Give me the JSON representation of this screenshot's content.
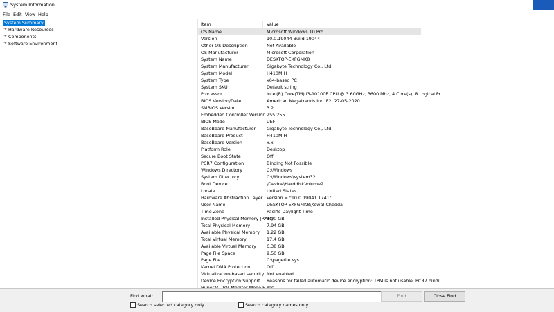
{
  "window": {
    "title": "System Information",
    "accent_color": "#1a5ab8"
  },
  "menu": [
    {
      "label": "File"
    },
    {
      "label": "Edit"
    },
    {
      "label": "View"
    },
    {
      "label": "Help"
    }
  ],
  "tree": [
    {
      "label": "System Summary",
      "expander": "",
      "selected": true
    },
    {
      "label": "Hardware Resources",
      "expander": "+"
    },
    {
      "label": "Components",
      "expander": "+"
    },
    {
      "label": "Software Environment",
      "expander": "+"
    }
  ],
  "table": {
    "headers": {
      "item": "Item",
      "value": "Value"
    },
    "rows": [
      {
        "item": "OS Name",
        "value": "Microsoft Windows 10 Pro"
      },
      {
        "item": "Version",
        "value": "10.0.19044 Build 19044"
      },
      {
        "item": "Other OS Description",
        "value": "Not Available"
      },
      {
        "item": "OS Manufacturer",
        "value": "Microsoft Corporation"
      },
      {
        "item": "System Name",
        "value": "DESKTOP-EKFGMK8"
      },
      {
        "item": "System Manufacturer",
        "value": "Gigabyte Technology Co., Ltd."
      },
      {
        "item": "System Model",
        "value": "H410M H"
      },
      {
        "item": "System Type",
        "value": "x64-based PC"
      },
      {
        "item": "System SKU",
        "value": "Default string"
      },
      {
        "item": "Processor",
        "value": "Intel(R) Core(TM) i3-10100F CPU @ 3.60GHz, 3600 Mhz, 4 Core(s), 8 Logical Pr..."
      },
      {
        "item": "BIOS Version/Date",
        "value": "American Megatrends Inc. F2, 27-05-2020"
      },
      {
        "item": "SMBIOS Version",
        "value": "3.2"
      },
      {
        "item": "Embedded Controller Version",
        "value": "255.255"
      },
      {
        "item": "BIOS Mode",
        "value": "UEFI"
      },
      {
        "item": "BaseBoard Manufacturer",
        "value": "Gigabyte Technology Co., Ltd."
      },
      {
        "item": "BaseBoard Product",
        "value": "H410M H"
      },
      {
        "item": "BaseBoard Version",
        "value": "x.x"
      },
      {
        "item": "Platform Role",
        "value": "Desktop"
      },
      {
        "item": "Secure Boot State",
        "value": "Off"
      },
      {
        "item": "PCR7 Configuration",
        "value": "Binding Not Possible"
      },
      {
        "item": "Windows Directory",
        "value": "C:\\Windows"
      },
      {
        "item": "System Directory",
        "value": "C:\\Windows\\system32"
      },
      {
        "item": "Boot Device",
        "value": "\\Device\\HarddiskVolume2"
      },
      {
        "item": "Locale",
        "value": "United States"
      },
      {
        "item": "Hardware Abstraction Layer",
        "value": "Version = \"10.0.19041.1741\""
      },
      {
        "item": "User Name",
        "value": "DESKTOP-EKFGMK8\\Kewal-Chedda"
      },
      {
        "item": "Time Zone",
        "value": "Pacific Daylight Time"
      },
      {
        "item": "Installed Physical Memory (RAM)",
        "value": "8.00 GB"
      },
      {
        "item": "Total Physical Memory",
        "value": "7.94 GB"
      },
      {
        "item": "Available Physical Memory",
        "value": "1.22 GB"
      },
      {
        "item": "Total Virtual Memory",
        "value": "17.4 GB"
      },
      {
        "item": "Available Virtual Memory",
        "value": "6.38 GB"
      },
      {
        "item": "Page File Space",
        "value": "9.50 GB"
      },
      {
        "item": "Page File",
        "value": "C:\\pagefile.sys"
      },
      {
        "item": "Kernel DMA Protection",
        "value": "Off"
      },
      {
        "item": "Virtualization-based security",
        "value": "Not enabled"
      },
      {
        "item": "Device Encryption Support",
        "value": "Reasons for failed automatic device encryption: TPM is not usable, PCR7 bindi..."
      },
      {
        "item": "Hyper-V - VM Monitor Mode E...",
        "value": "Yes"
      }
    ]
  },
  "find": {
    "label": "Find what:",
    "value": "",
    "find_button": "Find",
    "close_button": "Close Find",
    "option1": "Search selected category only",
    "option2": "Search category names only"
  }
}
